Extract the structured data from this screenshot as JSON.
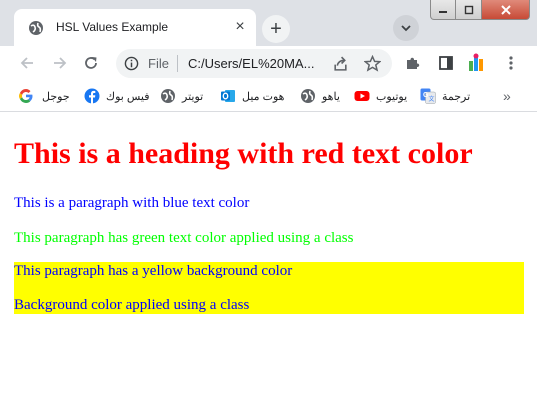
{
  "browser": {
    "tab": {
      "title": "HSL Values Example",
      "close_glyph": "×",
      "favicon": "globe-icon"
    },
    "new_tab_glyph": "+",
    "omnibox": {
      "scheme_label": "File",
      "url": "C:/Users/EL%20MA..."
    },
    "bookmarks": [
      {
        "label": "ترجمة",
        "icon": "google-translate-icon",
        "color": "#4285f4"
      },
      {
        "label": "يوتيوب",
        "icon": "youtube-icon",
        "color": "#ff0000"
      },
      {
        "label": "ياهو",
        "icon": "globe-icon",
        "color": "#5f6368"
      },
      {
        "label": "هوت ميل",
        "icon": "outlook-icon",
        "color": "#0078d4"
      },
      {
        "label": "تويتر",
        "icon": "globe-icon",
        "color": "#5f6368"
      },
      {
        "label": "فيس بوك",
        "icon": "facebook-icon",
        "color": "#1877f2"
      },
      {
        "label": "جوجل",
        "icon": "google-icon",
        "color": "#4285f4"
      }
    ],
    "overflow_glyph": "»"
  },
  "page": {
    "heading": "This is a heading with red text color",
    "paragraph_blue": "This is a paragraph with blue text color",
    "paragraph_green": "This paragraph has green text color applied using a class",
    "paragraph_yellow_bg": "This paragraph has a yellow background color",
    "paragraph_yellow_class": "Background color applied using a class",
    "colors": {
      "red": "#ff0000",
      "blue": "#0000ff",
      "green": "#00ff00",
      "yellow": "#ffff00"
    }
  }
}
